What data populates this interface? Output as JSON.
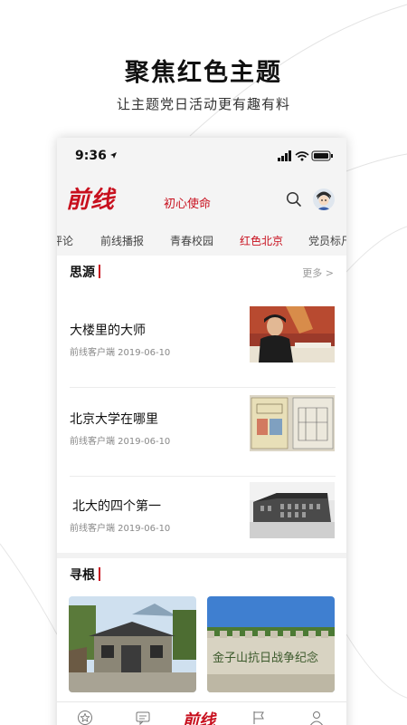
{
  "promo": {
    "title": "聚焦红色主题",
    "subtitle": "让主题党日活动更有趣有料"
  },
  "statusbar": {
    "time": "9:36"
  },
  "appbar": {
    "logo": "前线",
    "title": "初心使命"
  },
  "tabs": [
    {
      "label": "评论",
      "active": false
    },
    {
      "label": "前线播报",
      "active": false
    },
    {
      "label": "青春校园",
      "active": false
    },
    {
      "label": "红色北京",
      "active": true
    },
    {
      "label": "党员标尺",
      "active": false
    }
  ],
  "section1": {
    "title": "思源",
    "more": "更多 >",
    "articles": [
      {
        "title": "大楼里的大师",
        "meta": "前线客户端 2019-06-10"
      },
      {
        "title": "北京大学在哪里",
        "meta": "前线客户端 2019-06-10"
      },
      {
        "title": "北大的四个第一",
        "meta": "前线客户端 2019-06-10"
      }
    ]
  },
  "section2": {
    "title": "寻根",
    "cards": [
      {
        "caption": ""
      },
      {
        "caption": "金子山抗日战争纪念"
      }
    ]
  },
  "bottom_nav": {
    "logo": "前线"
  },
  "colors": {
    "accent": "#c8101e",
    "background": "#ffffff",
    "bar": "#f4f4f4"
  }
}
